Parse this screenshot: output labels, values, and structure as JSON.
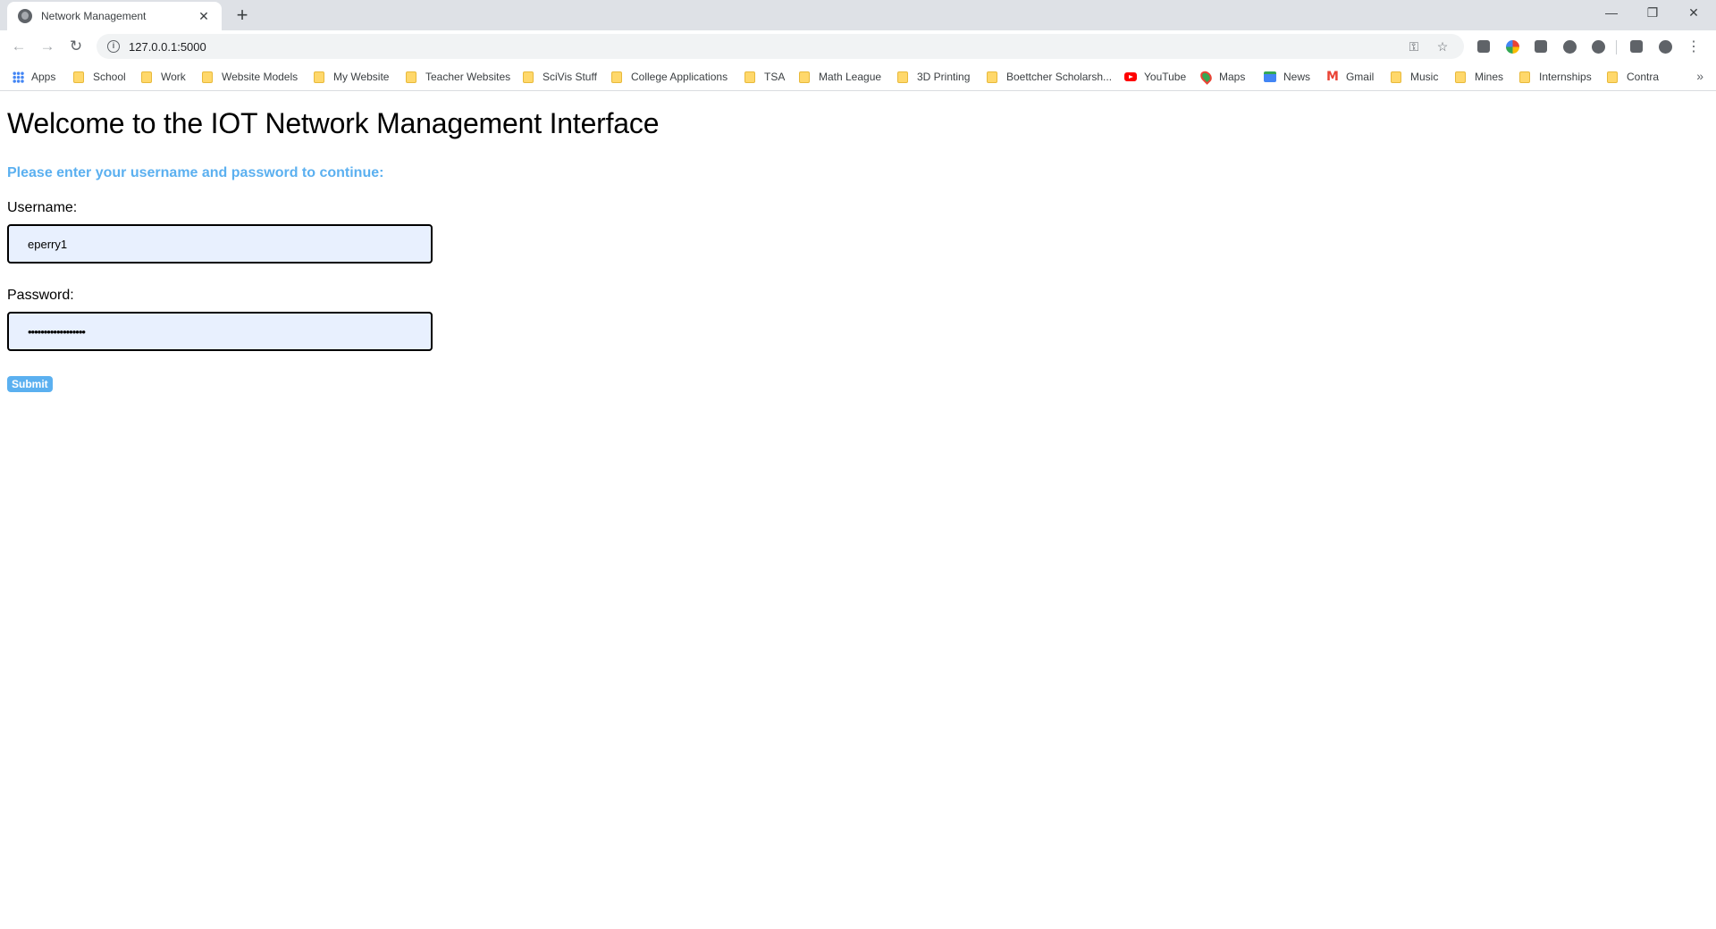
{
  "browser": {
    "tab_title": "Network Management",
    "tab_close": "✕",
    "new_tab": "+",
    "window_controls": {
      "minimize": "—",
      "restore": "❐",
      "close": "✕"
    },
    "nav": {
      "back": "←",
      "forward": "→",
      "reload": "↻"
    },
    "address_info": "i",
    "url": "127.0.0.1:5000",
    "omnibox_icons": {
      "key": "⚿",
      "bookmark_star": "☆"
    },
    "menu": "⋮",
    "bookmarks": [
      {
        "label": "Apps",
        "icon": "apps-grid"
      },
      {
        "label": "School",
        "icon": "folder"
      },
      {
        "label": "Work",
        "icon": "folder"
      },
      {
        "label": "Website Models",
        "icon": "folder"
      },
      {
        "label": "My Website",
        "icon": "folder"
      },
      {
        "label": "Teacher Websites",
        "icon": "folder"
      },
      {
        "label": "SciVis Stuff",
        "icon": "folder"
      },
      {
        "label": "College Applications",
        "icon": "folder"
      },
      {
        "label": "TSA",
        "icon": "folder"
      },
      {
        "label": "Math League",
        "icon": "folder"
      },
      {
        "label": "3D Printing",
        "icon": "folder"
      },
      {
        "label": "Boettcher Scholarsh...",
        "icon": "folder"
      },
      {
        "label": "YouTube",
        "icon": "youtube"
      },
      {
        "label": "Maps",
        "icon": "maps"
      },
      {
        "label": "News",
        "icon": "news"
      },
      {
        "label": "Gmail",
        "icon": "gmail"
      },
      {
        "label": "Music",
        "icon": "folder"
      },
      {
        "label": "Mines",
        "icon": "folder"
      },
      {
        "label": "Internships",
        "icon": "folder"
      },
      {
        "label": "Contra",
        "icon": "folder"
      }
    ],
    "bookmarks_more": "»"
  },
  "page": {
    "title": "Welcome to the IOT Network Management Interface",
    "subtitle": "Please enter your username and password to continue:",
    "username_label": "Username:",
    "username_value": "eperry1",
    "password_label": "Password:",
    "password_value": "••••••••••••••••••",
    "submit_label": "Submit"
  },
  "colors": {
    "accent": "#5bb0f0",
    "input_fill": "#e8f0fe"
  }
}
